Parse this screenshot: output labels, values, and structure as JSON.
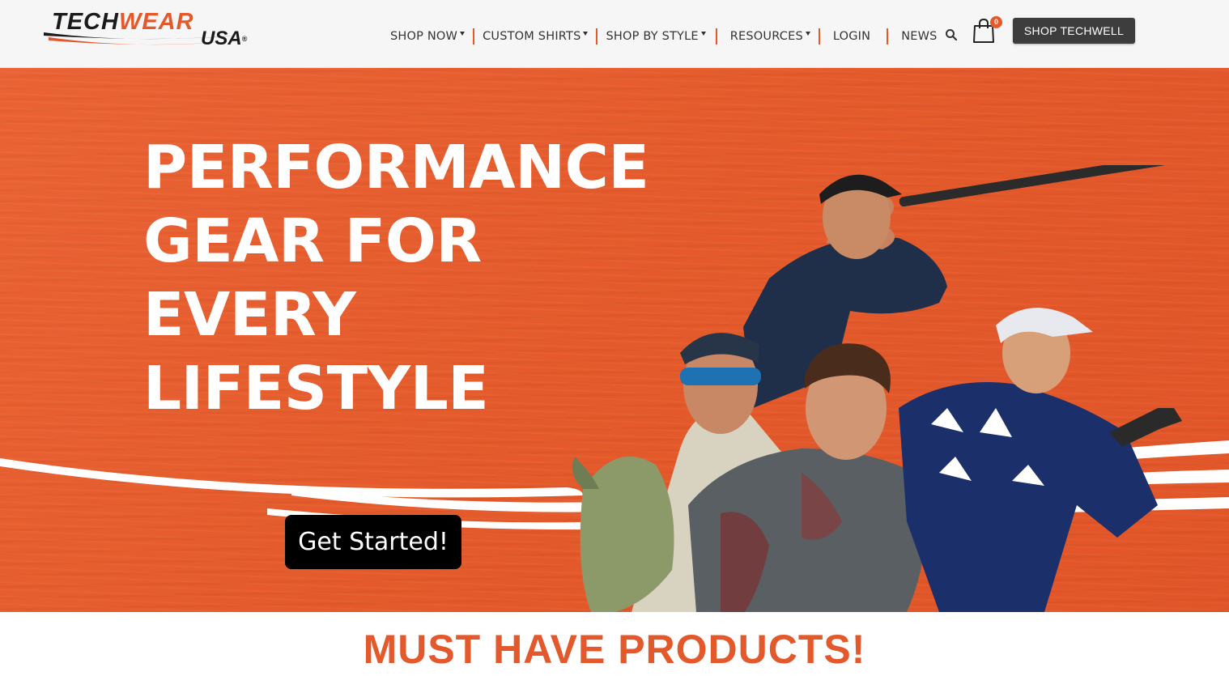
{
  "logo": {
    "part1": "TECH",
    "part2": "WEAR",
    "part3": "USA",
    "registered": "®"
  },
  "nav": {
    "items": [
      {
        "label": "SHOP NOW",
        "dropdown": true
      },
      {
        "label": "CUSTOM SHIRTS",
        "dropdown": true
      },
      {
        "label": "SHOP BY STYLE",
        "dropdown": true
      },
      {
        "label": "RESOURCES",
        "dropdown": true
      },
      {
        "label": "LOGIN",
        "dropdown": false
      },
      {
        "label": "NEWS",
        "dropdown": false
      }
    ],
    "search_icon": "search-icon",
    "cart_icon": "shopping-bag-icon",
    "cart_count": "0",
    "shop_techwell_label": "SHOP TECHWELL"
  },
  "hero": {
    "title_lines": [
      "PERFORMANCE",
      "GEAR FOR",
      "EVERY",
      "LIFESTYLE"
    ],
    "cta_label": "Get Started!",
    "background_color": "#e45a2b"
  },
  "section": {
    "heading": "MUST HAVE PRODUCTS!"
  },
  "colors": {
    "accent": "#e3592b",
    "dark_button": "#3d3d3d",
    "cta": "#000000"
  }
}
